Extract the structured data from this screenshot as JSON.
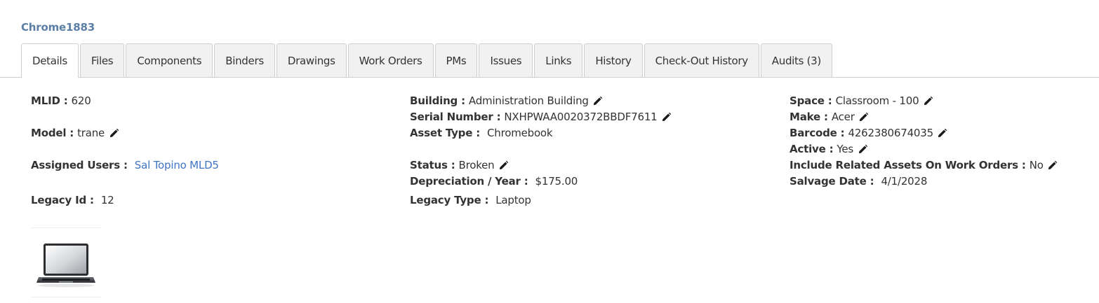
{
  "asset": {
    "title": "Chrome1883"
  },
  "tabs": [
    {
      "label": "Details",
      "active": true
    },
    {
      "label": "Files"
    },
    {
      "label": "Components"
    },
    {
      "label": "Binders"
    },
    {
      "label": "Drawings"
    },
    {
      "label": "Work Orders"
    },
    {
      "label": "PMs"
    },
    {
      "label": "Issues"
    },
    {
      "label": "Links"
    },
    {
      "label": "History"
    },
    {
      "label": "Check-Out History"
    },
    {
      "label": "Audits (3)"
    }
  ],
  "details": {
    "mlid": {
      "label": "MLID :",
      "value": "620"
    },
    "model": {
      "label": "Model :",
      "value": "trane"
    },
    "assigned_users": {
      "label": "Assigned Users :",
      "value": "Sal Topino MLD5"
    },
    "legacy_id": {
      "label": "Legacy Id :",
      "value": "12"
    },
    "building": {
      "label": "Building :",
      "value": "Administration Building"
    },
    "serial_number": {
      "label": "Serial Number :",
      "value": "NXHPWAA0020372BBDF7611"
    },
    "asset_type": {
      "label": "Asset Type :",
      "value": "Chromebook"
    },
    "status": {
      "label": "Status :",
      "value": "Broken"
    },
    "depreciation": {
      "label": "Depreciation / Year :",
      "value": "$175.00"
    },
    "legacy_type": {
      "label": "Legacy Type :",
      "value": "Laptop"
    },
    "space": {
      "label": "Space :",
      "value": "Classroom - 100"
    },
    "make": {
      "label": "Make :",
      "value": "Acer"
    },
    "barcode": {
      "label": "Barcode :",
      "value": "4262380674035"
    },
    "active": {
      "label": "Active :",
      "value": "Yes"
    },
    "include_related": {
      "label": "Include Related Assets On Work Orders :",
      "value": "No"
    },
    "salvage_date": {
      "label": "Salvage Date :",
      "value": "4/1/2028"
    }
  },
  "icons": {
    "edit": "pencil-icon",
    "image": "laptop-image"
  },
  "colors": {
    "title": "#5b7fa6",
    "link": "#3f74c6",
    "tab_bg": "#f1f1f1",
    "border": "#cfcfcf"
  }
}
